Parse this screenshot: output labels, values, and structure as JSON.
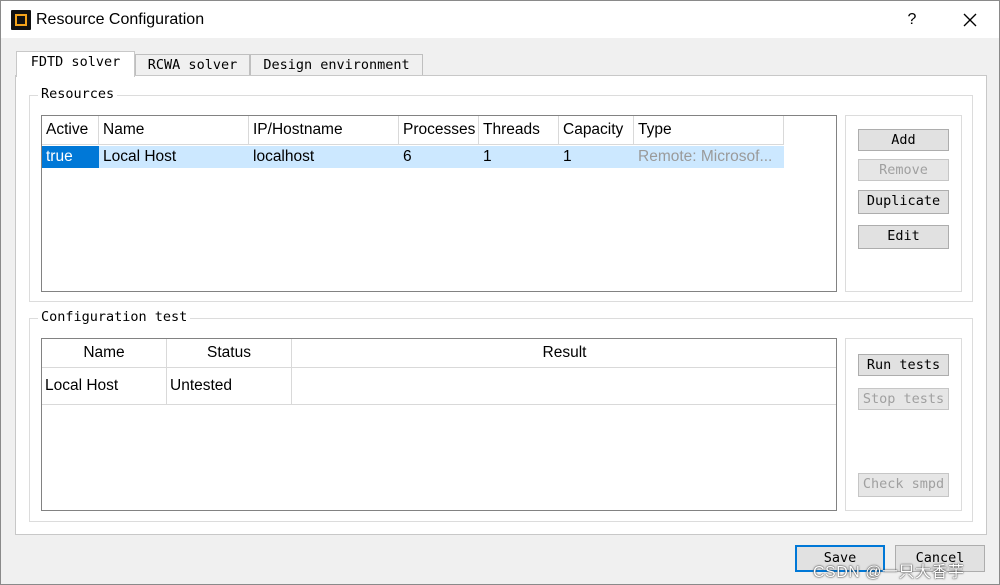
{
  "window": {
    "title": "Resource Configuration",
    "help_label": "?"
  },
  "tabs": [
    {
      "label": "FDTD solver",
      "active": true
    },
    {
      "label": "RCWA solver",
      "active": false
    },
    {
      "label": "Design environment",
      "active": false
    }
  ],
  "resources": {
    "group_title": "Resources",
    "columns": [
      "Active",
      "Name",
      "IP/Hostname",
      "Processes",
      "Threads",
      "Capacity",
      "Type"
    ],
    "rows": [
      {
        "active": "true",
        "name": "Local Host",
        "host": "localhost",
        "processes": "6",
        "threads": "1",
        "capacity": "1",
        "type": "Remote: Microsof..."
      }
    ],
    "buttons": {
      "add": "Add",
      "remove": "Remove",
      "duplicate": "Duplicate",
      "edit": "Edit"
    }
  },
  "config_test": {
    "group_title": "Configuration test",
    "columns": [
      "Name",
      "Status",
      "Result"
    ],
    "rows": [
      {
        "name": "Local Host",
        "status": "Untested",
        "result": ""
      }
    ],
    "buttons": {
      "run": "Run tests",
      "stop": "Stop tests",
      "check": "Check smpd"
    }
  },
  "footer": {
    "save": "Save",
    "cancel": "Cancel"
  },
  "watermark": "CSDN @一只大香芋",
  "colors": {
    "selection": "#cce8ff",
    "active_cell": "#0078d7",
    "default_button_border": "#0078d7"
  }
}
